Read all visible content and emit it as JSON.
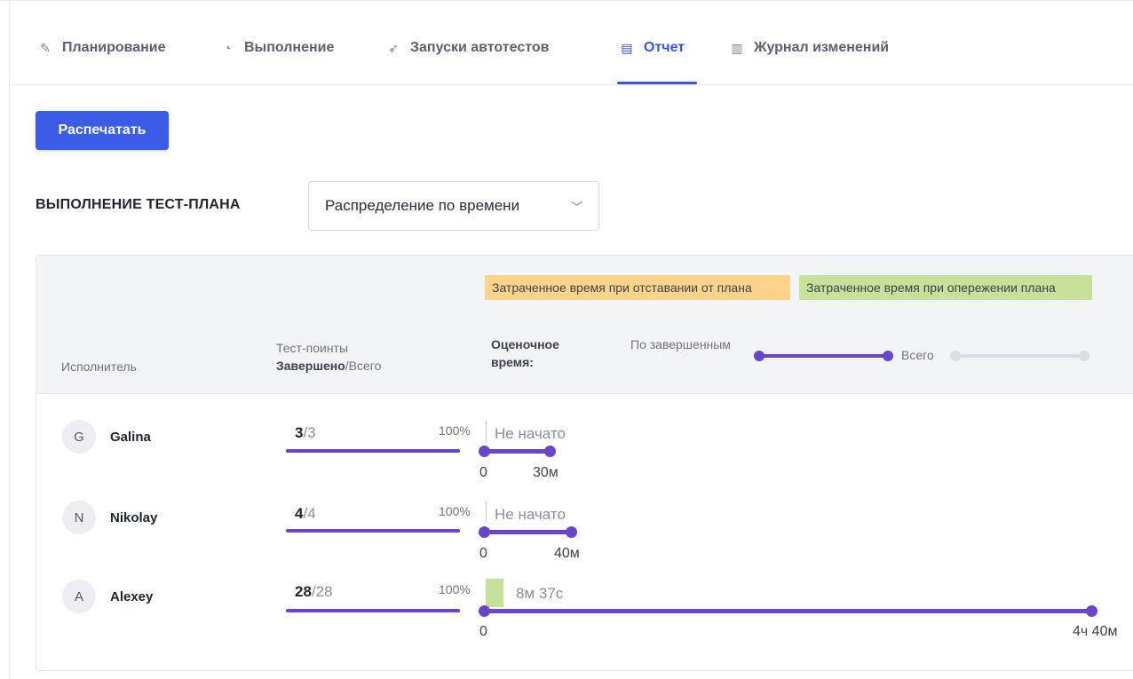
{
  "tabs": [
    {
      "label": "Планирование",
      "icon": "clipboard-icon"
    },
    {
      "label": "Выполнение",
      "icon": "gauge-icon"
    },
    {
      "label": "Запуски автотестов",
      "icon": "rocket-icon"
    },
    {
      "label": "Отчет",
      "icon": "report-icon",
      "active": true
    },
    {
      "label": "Журнал изменений",
      "icon": "book-icon"
    }
  ],
  "print_button": "Распечатать",
  "section": {
    "title": "ВЫПОЛНЕНИЕ ТЕСТ-ПЛАНА",
    "select_value": "Распределение по времени"
  },
  "table": {
    "col_executor": "Исполнитель",
    "col_testpoints_line1": "Тест-поинты",
    "col_testpoints_done": "Завершено",
    "col_testpoints_total": "/Всего",
    "legend_behind": "Затраченное время при отставании от плана",
    "legend_ahead": "Затраченное время при опережении плана",
    "estimate_label": "Оценочное время:",
    "toggle_by_completed": "По завершенным",
    "toggle_total": "Всего",
    "rows": [
      {
        "initial": "G",
        "name": "Galina",
        "done": "3",
        "total": "/3",
        "percent": "100%",
        "status": "Не начато",
        "zero": "0",
        "estimate": "30м"
      },
      {
        "initial": "N",
        "name": "Nikolay",
        "done": "4",
        "total": "/4",
        "percent": "100%",
        "status": "Не начато",
        "zero": "0",
        "estimate": "40м"
      },
      {
        "initial": "A",
        "name": "Alexey",
        "done": "28",
        "total": "/28",
        "percent": "100%",
        "status": "8м 37с",
        "zero": "0",
        "estimate": "4ч 40м"
      }
    ]
  },
  "colors": {
    "accent": "#3b55d9",
    "button": "#3b5ce6",
    "progress": "#6a45c9",
    "behind": "#ffd48a",
    "ahead": "#c6e29a"
  }
}
